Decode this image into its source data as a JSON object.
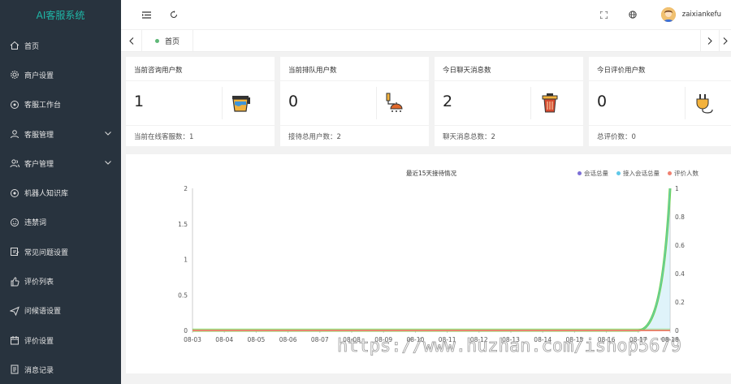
{
  "app": {
    "title": "AI客服系统"
  },
  "sidebar": {
    "items": [
      {
        "label": "首页",
        "icon": "home-icon",
        "has_children": false
      },
      {
        "label": "商户设置",
        "icon": "gear-icon",
        "has_children": false
      },
      {
        "label": "客服工作台",
        "icon": "chat-icon",
        "has_children": false
      },
      {
        "label": "客服管理",
        "icon": "user-icon",
        "has_children": true
      },
      {
        "label": "客户管理",
        "icon": "users-icon",
        "has_children": true
      },
      {
        "label": "机器人知识库",
        "icon": "robot-icon",
        "has_children": false
      },
      {
        "label": "违禁词",
        "icon": "smile-icon",
        "has_children": false
      },
      {
        "label": "常见问题设置",
        "icon": "edit-icon",
        "has_children": false
      },
      {
        "label": "评价列表",
        "icon": "thumb-icon",
        "has_children": false
      },
      {
        "label": "问候语设置",
        "icon": "send-icon",
        "has_children": false
      },
      {
        "label": "评价设置",
        "icon": "calendar-icon",
        "has_children": false
      },
      {
        "label": "消息记录",
        "icon": "doc-icon",
        "has_children": false
      }
    ]
  },
  "header": {
    "username": "zaixiankefu"
  },
  "tabs": {
    "active": "首页"
  },
  "cards": [
    {
      "title": "当前咨询用户数",
      "value": "1",
      "footer": "当前在线客服数：1",
      "icon": "bucket-icon",
      "color": "#f0a020"
    },
    {
      "title": "当前排队用户数",
      "value": "0",
      "footer": "接待总用户数：2",
      "icon": "shower-icon",
      "color": "#e0682a"
    },
    {
      "title": "今日聊天消息数",
      "value": "2",
      "footer": "聊天消息总数：2",
      "icon": "trash-icon",
      "color": "#d64a30"
    },
    {
      "title": "今日评价用户数",
      "value": "0",
      "footer": "总评价数：0",
      "icon": "plug-icon",
      "color": "#f0a020"
    }
  ],
  "chart_data": {
    "type": "line",
    "title": "最近15天接待情况",
    "categories": [
      "08-03",
      "08-04",
      "08-05",
      "08-06",
      "08-07",
      "08-08",
      "08-09",
      "08-10",
      "08-11",
      "08-12",
      "08-13",
      "08-14",
      "08-15",
      "08-16",
      "08-17",
      "08-18"
    ],
    "y_left": {
      "ylim": [
        0,
        2
      ],
      "ticks": [
        "0",
        "0.5",
        "1",
        "1.5",
        "2"
      ]
    },
    "y_right": {
      "ylim": [
        0,
        1
      ],
      "ticks": [
        "0",
        "0.2",
        "0.4",
        "0.6",
        "0.8",
        "1"
      ]
    },
    "series": [
      {
        "name": "会话总量",
        "color": "#7c6fd6",
        "axis": "left",
        "values": [
          0,
          0,
          0,
          0,
          0,
          0,
          0,
          0,
          0,
          0,
          0,
          0,
          0,
          0,
          0,
          2
        ]
      },
      {
        "name": "接入会话总量",
        "color": "#5fc8e8",
        "axis": "left",
        "values": [
          0,
          0,
          0,
          0,
          0,
          0,
          0,
          0,
          0,
          0,
          0,
          0,
          0,
          0,
          0,
          2
        ]
      },
      {
        "name": "评价人数",
        "color": "#f08070",
        "axis": "right",
        "values": [
          0,
          0,
          0,
          0,
          0,
          0,
          0,
          0,
          0,
          0,
          0,
          0,
          0,
          0,
          0,
          0
        ]
      }
    ],
    "legend_position": "top-right",
    "highlight_color": "#6fd34a"
  },
  "watermark": "https://www.huzhan.com/ishop5679"
}
